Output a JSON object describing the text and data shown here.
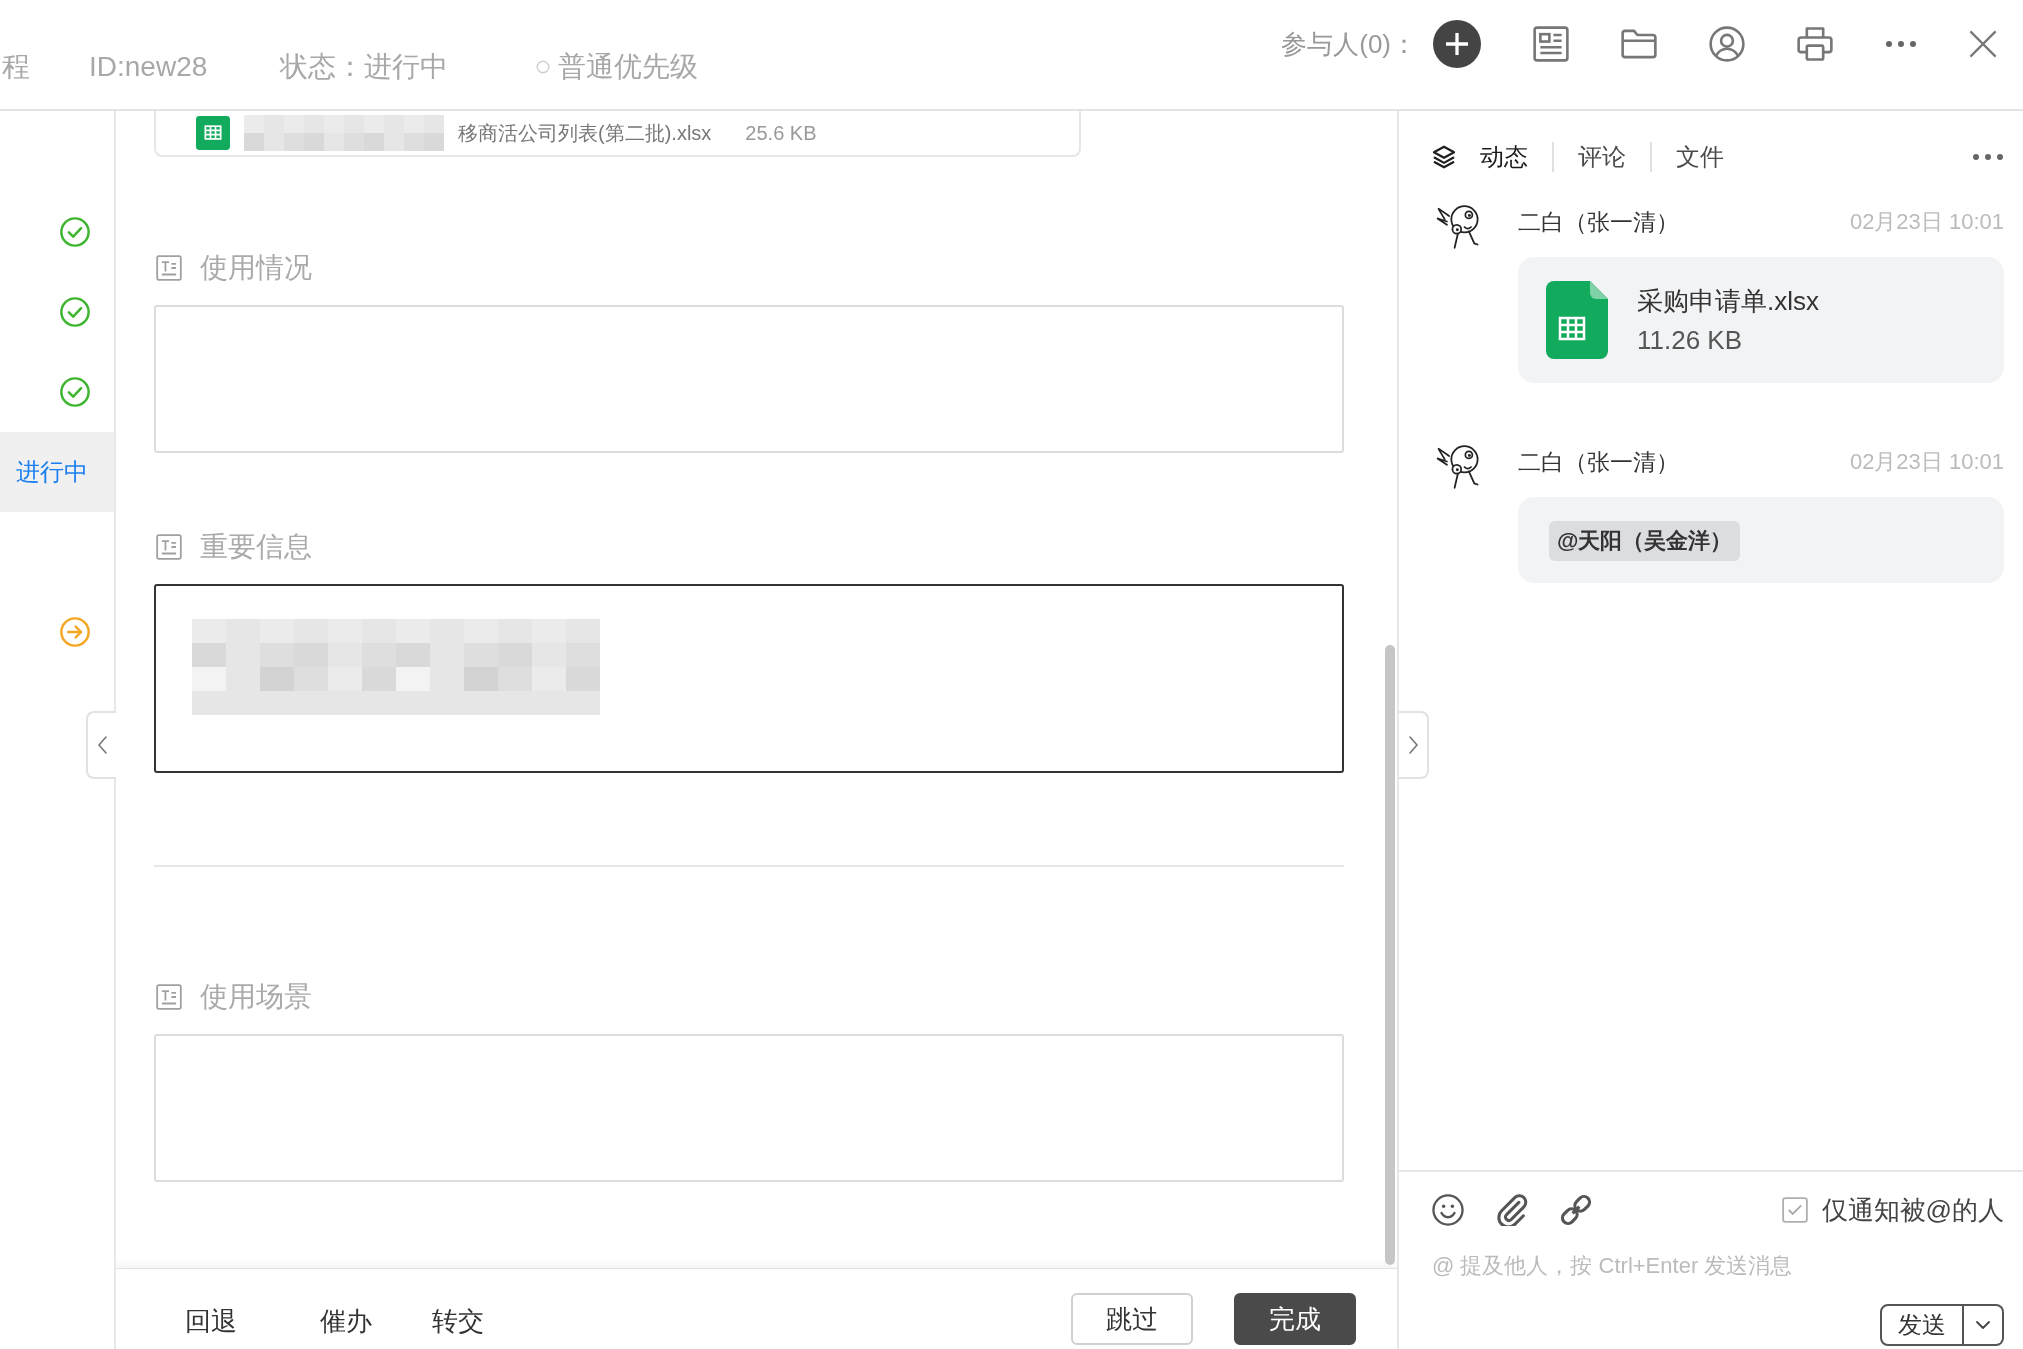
{
  "header": {
    "title_fragment": "程",
    "task_id": "ID:new28",
    "status": "状态：进行中",
    "priority": {
      "label": "普通优先级"
    },
    "participants_label": "参与人(0)："
  },
  "sidebar": {
    "steps": [
      {
        "kind": "done",
        "selected": false
      },
      {
        "kind": "done",
        "selected": false
      },
      {
        "kind": "done",
        "selected": false
      },
      {
        "kind": "current",
        "label": "进行中",
        "selected": true
      },
      {
        "kind": "pending",
        "selected": false
      }
    ]
  },
  "main": {
    "attachment": {
      "name": "移商活公司列表(第二批).xlsx",
      "size": "25.6 KB",
      "redacted": true
    },
    "fields": [
      {
        "kind": "textarea",
        "label": "使用情况",
        "focused": false
      },
      {
        "kind": "textarea",
        "label": "重要信息",
        "focused": true,
        "redacted": true
      },
      {
        "kind": "divider"
      },
      {
        "kind": "textarea",
        "label": "使用场景",
        "focused": false
      }
    ]
  },
  "footer": {
    "actions": [
      {
        "label": "回退"
      },
      {
        "label": "催办"
      },
      {
        "label": "转交"
      }
    ],
    "buttons": [
      {
        "kind": "secondary",
        "label": "跳过"
      },
      {
        "kind": "primary",
        "label": "完成"
      }
    ]
  },
  "right_panel": {
    "tabs": [
      {
        "label": "动态",
        "selected": true
      },
      {
        "label": "评论",
        "selected": false
      },
      {
        "label": "文件",
        "selected": false
      }
    ],
    "feed": [
      {
        "kind": "file",
        "author": "二白（张一清）",
        "time": "02月23日 10:01",
        "file": {
          "name": "采购申请单.xlsx",
          "size": "11.26 KB"
        }
      },
      {
        "kind": "mention",
        "author": "二白（张一清）",
        "time": "02月23日 10:01",
        "mention": "@天阳（吴金洋）"
      }
    ],
    "composer": {
      "notify": {
        "label": "仅通知被@的人",
        "checked": true
      },
      "placeholder": "@ 提及他人，按 Ctrl+Enter 发送消息",
      "send_label": "发送"
    }
  }
}
